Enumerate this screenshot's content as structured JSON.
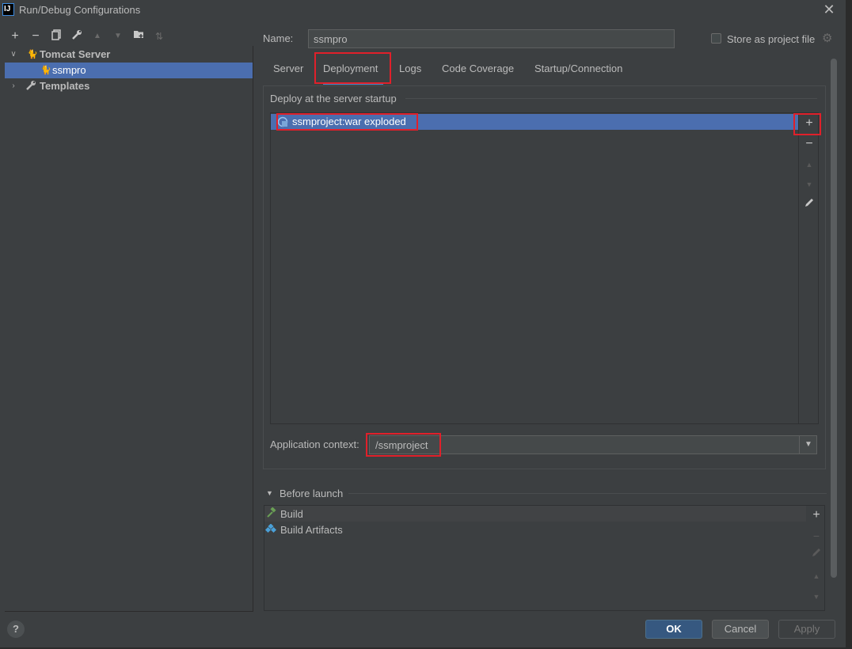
{
  "window": {
    "title": "Run/Debug Configurations",
    "app_icon": "IJ"
  },
  "toolbar": {
    "add": "+",
    "remove": "−"
  },
  "tree": {
    "items": [
      {
        "label": "Tomcat Server"
      },
      {
        "label": "ssmpro"
      },
      {
        "label": "Templates"
      }
    ]
  },
  "form": {
    "name_label": "Name:",
    "name_value": "ssmpro",
    "store_label": "Store as project file"
  },
  "tabs": [
    {
      "label": "Server"
    },
    {
      "label": "Deployment"
    },
    {
      "label": "Logs"
    },
    {
      "label": "Code Coverage"
    },
    {
      "label": "Startup/Connection"
    }
  ],
  "deployment": {
    "group_label": "Deploy at the server startup",
    "artifacts": [
      {
        "label": "ssmproject:war exploded"
      }
    ],
    "context_label": "Application context:",
    "context_value": "/ssmproject"
  },
  "before_launch": {
    "label": "Before launch",
    "items": [
      {
        "label": "Build"
      },
      {
        "label": "Build Artifacts"
      }
    ]
  },
  "buttons": {
    "ok": "OK",
    "cancel": "Cancel",
    "apply": "Apply",
    "help": "?"
  },
  "colors": {
    "background": "#3c3f41",
    "selection": "#4b6eaf",
    "highlight": "#e0202a",
    "ok_button": "#365880"
  }
}
